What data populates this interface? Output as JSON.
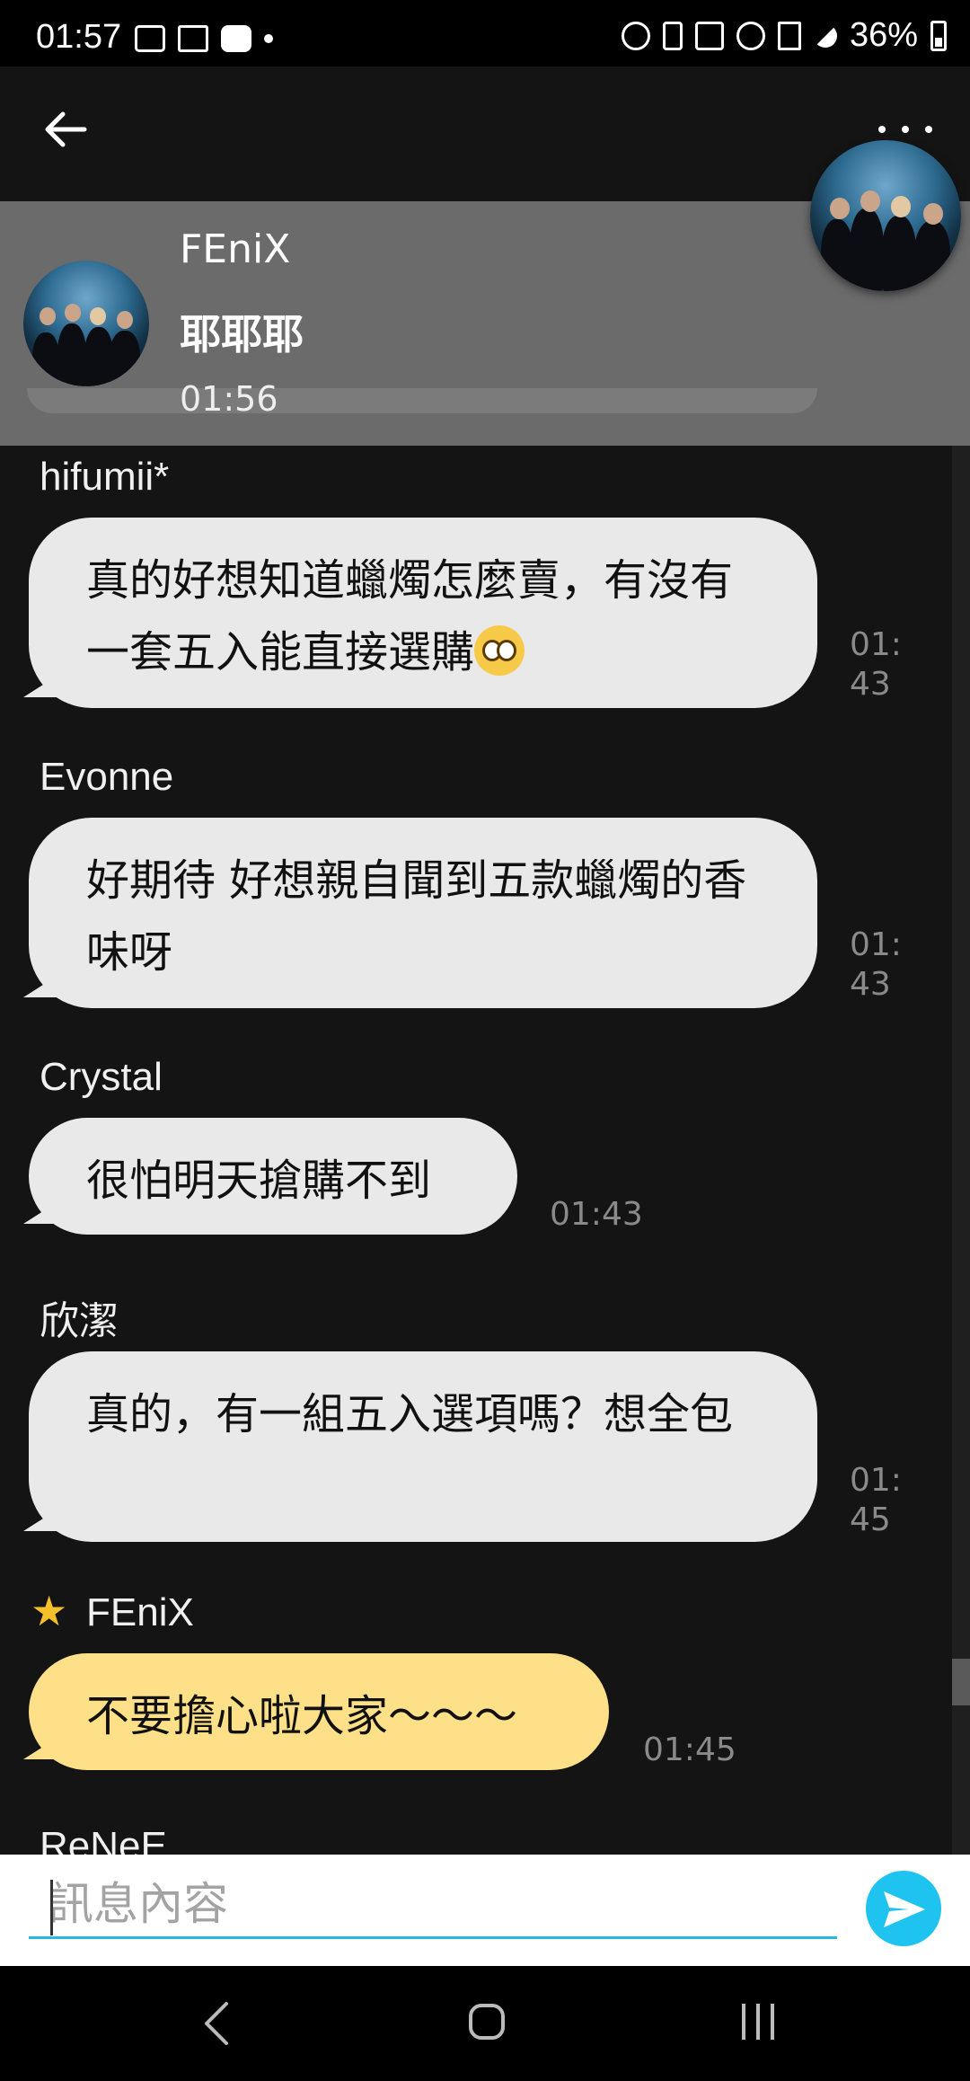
{
  "status_bar": {
    "time": "01:57",
    "battery": "36%"
  },
  "pinned": {
    "sender": "FEniX",
    "message": "耶耶耶",
    "time": "01:56"
  },
  "messages": [
    {
      "sender": "hifumii*",
      "text": "真的好想知道蠟燭怎麼賣，有沒有一套五入能直接選購",
      "emoji": "pleading-face",
      "time": "01:\n43"
    },
    {
      "sender": "Evonne",
      "text": "好期待 好想親自聞到五款蠟燭的香味呀",
      "time": "01:\n43"
    },
    {
      "sender": "Crystal",
      "text": "很怕明天搶購不到",
      "time": "01:43"
    },
    {
      "sender": "欣潔",
      "text": "真的，有一組五入選項嗎？想全包",
      "time": "01:\n45"
    },
    {
      "sender": "FEniX",
      "text": "不要擔心啦大家～～～",
      "time": "01:45",
      "highlight": "#fde088",
      "badge": "star-icon"
    },
    {
      "sender": "ReNeE"
    }
  ],
  "input": {
    "placeholder": "訊息內容"
  },
  "colors": {
    "accent": "#1fc3f0",
    "host_bubble": "#fde088",
    "bubble": "#e9e9e9"
  }
}
